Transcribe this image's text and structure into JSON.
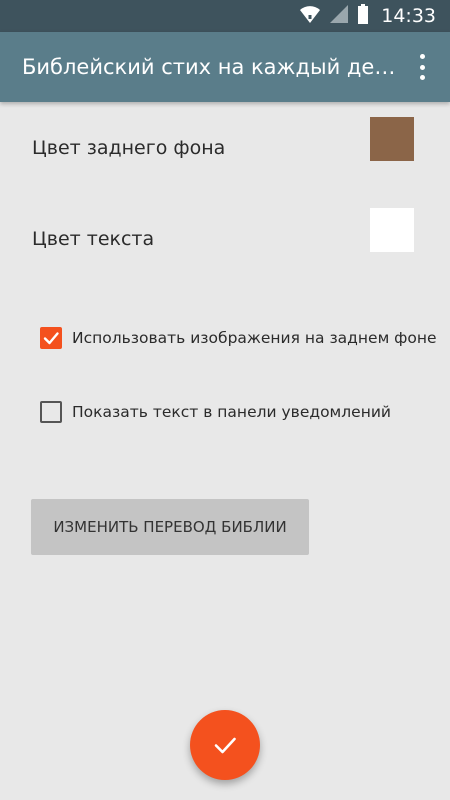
{
  "status_bar": {
    "time": "14:33",
    "icons": [
      "wifi-icon",
      "signal-icon",
      "battery-icon"
    ]
  },
  "app_bar": {
    "title": "Библейский стих на каждый день",
    "menu_icon": "more-vert-icon"
  },
  "preferences": {
    "background_color": {
      "label": "Цвет заднего фона",
      "color": "#8b6548"
    },
    "text_color": {
      "label": "Цвет текста",
      "color": "#ffffff"
    }
  },
  "options": [
    {
      "label": "Использовать изображения на заднем фоне",
      "checked": true
    },
    {
      "label": "Показать текст в панели уведомлений",
      "checked": false
    }
  ],
  "change_translation_button": "ИЗМЕНИТЬ ПЕРЕВОД БИБЛИИ",
  "fab_icon": "check-icon",
  "colors": {
    "status_bar": "#3e535d",
    "app_bar": "#5a7d8a",
    "accent": "#f4511e",
    "background": "#e8e8e8",
    "button": "#c4c4c4"
  }
}
